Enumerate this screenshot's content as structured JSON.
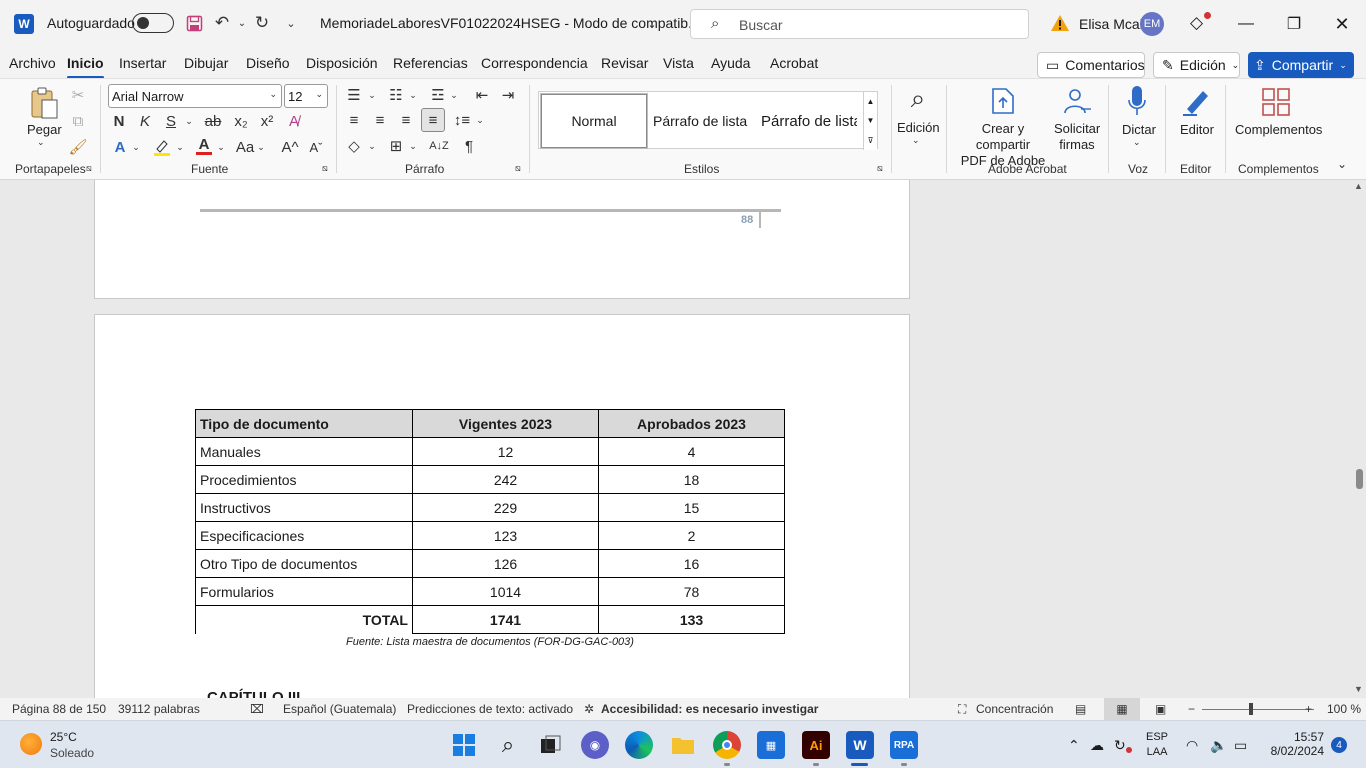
{
  "titlebar": {
    "autosave_label": "Autoguardado",
    "doc_title": "MemoriadeLaboresVF01022024HSEG  -  Modo de compatib...",
    "search_placeholder": "Buscar",
    "user_name": "Elisa Mcal",
    "user_initials": "EM"
  },
  "menu": {
    "tabs": [
      "Archivo",
      "Inicio",
      "Insertar",
      "Dibujar",
      "Diseño",
      "Disposición",
      "Referencias",
      "Correspondencia",
      "Revisar",
      "Vista",
      "Ayuda",
      "Acrobat"
    ],
    "active_tab": "Inicio",
    "comments_label": "Comentarios",
    "editing_label": "Edición",
    "share_label": "Compartir"
  },
  "ribbon": {
    "paste_label": "Pegar",
    "font_name": "Arial Narrow",
    "font_size": "12",
    "styles": [
      "Normal",
      "Párrafo de lista",
      "Párrafo de lista"
    ],
    "edicion_label": "Edición",
    "adobe_create_label_1": "Crear y compartir",
    "adobe_create_label_2": "PDF de Adobe",
    "adobe_sign_label_1": "Solicitar",
    "adobe_sign_label_2": "firmas",
    "dictate_label": "Dictar",
    "editor_label": "Editor",
    "addins_label": "Complementos",
    "groups": {
      "clipboard": "Portapapeles",
      "font": "Fuente",
      "paragraph": "Párrafo",
      "styles": "Estilos",
      "adobe": "Adobe Acrobat",
      "voice": "Voz",
      "editor": "Editor",
      "addins": "Complementos"
    }
  },
  "document": {
    "page_number": "88",
    "table": {
      "headers": [
        "Tipo de documento",
        "Vigentes 2023",
        "Aprobados 2023"
      ],
      "rows": [
        [
          "Manuales",
          "12",
          "4"
        ],
        [
          "Procedimientos",
          "242",
          "18"
        ],
        [
          "Instructivos",
          "229",
          "15"
        ],
        [
          "Especificaciones",
          "123",
          "2"
        ],
        [
          "Otro Tipo de documentos",
          "126",
          "16"
        ],
        [
          "Formularios",
          "1014",
          "78"
        ]
      ],
      "total_label": "TOTAL",
      "total_vigentes": "1741",
      "total_aprobados": "133"
    },
    "source_note": "Fuente: Lista maestra de documentos (FOR-DG-GAC-003)",
    "chapter_heading": "CAPÍTULO III"
  },
  "statusbar": {
    "page": "Página 88 de 150",
    "words": "39112 palabras",
    "language": "Español (Guatemala)",
    "predictions": "Predicciones de texto: activado",
    "accessibility": "Accesibilidad: es necesario investigar",
    "focus": "Concentración",
    "zoom": "100 %"
  },
  "taskbar": {
    "temperature": "25°C",
    "weather": "Soleado",
    "lang_1": "ESP",
    "lang_2": "LAA",
    "time": "15:57",
    "date": "8/02/2024",
    "notifications": "4"
  },
  "colors": {
    "accent": "#185abd",
    "table_header_bg": "#d9d9d9"
  }
}
